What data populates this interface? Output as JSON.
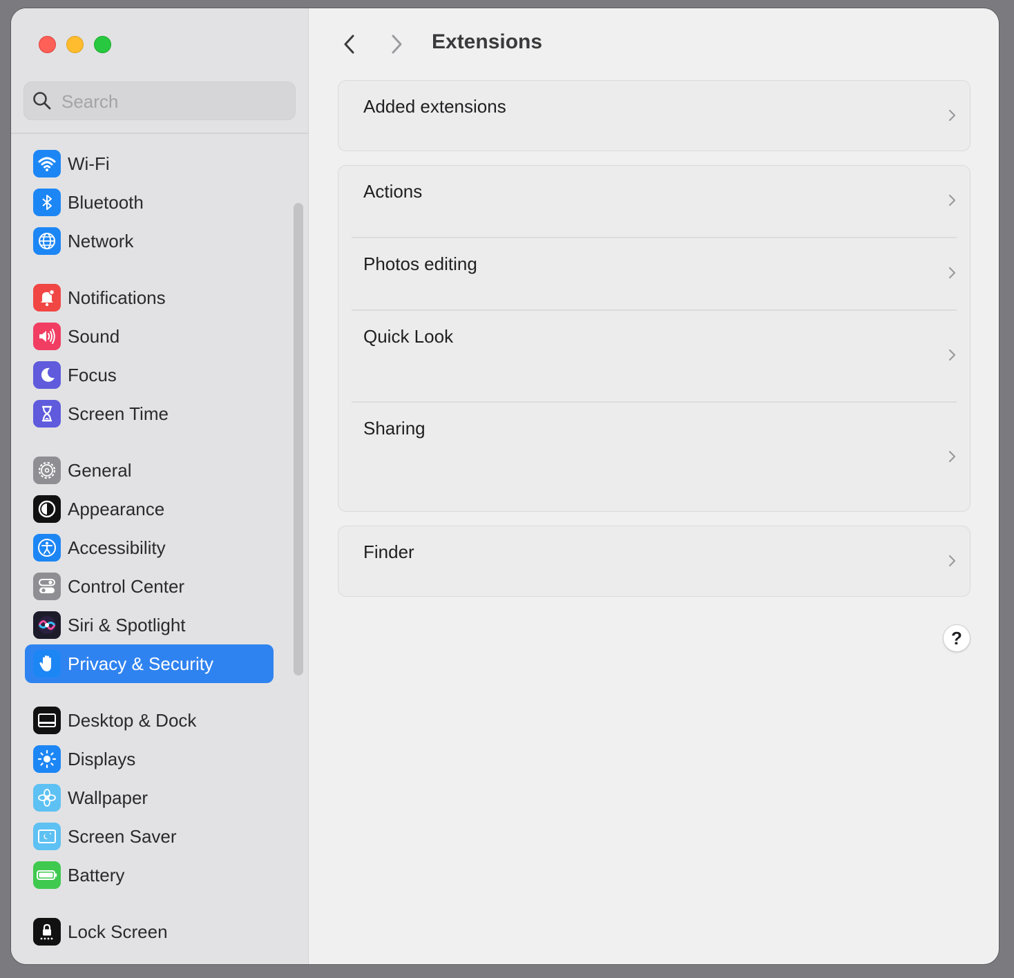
{
  "search": {
    "placeholder": "Search"
  },
  "sidebar": {
    "items": [
      {
        "label": "Wi-Fi",
        "icon": "wifi-icon"
      },
      {
        "label": "Bluetooth",
        "icon": "bluetooth-icon"
      },
      {
        "label": "Network",
        "icon": "globe-icon"
      },
      {
        "label": "Notifications",
        "icon": "bell-icon"
      },
      {
        "label": "Sound",
        "icon": "speaker-icon"
      },
      {
        "label": "Focus",
        "icon": "moon-icon"
      },
      {
        "label": "Screen Time",
        "icon": "hourglass-icon"
      },
      {
        "label": "General",
        "icon": "gear-icon"
      },
      {
        "label": "Appearance",
        "icon": "appearance-icon"
      },
      {
        "label": "Accessibility",
        "icon": "accessibility-icon"
      },
      {
        "label": "Control Center",
        "icon": "toggles-icon"
      },
      {
        "label": "Siri & Spotlight",
        "icon": "siri-icon"
      },
      {
        "label": "Privacy & Security",
        "icon": "hand-icon",
        "selected": true
      },
      {
        "label": "Desktop & Dock",
        "icon": "dock-icon"
      },
      {
        "label": "Displays",
        "icon": "sun-icon"
      },
      {
        "label": "Wallpaper",
        "icon": "flower-icon"
      },
      {
        "label": "Screen Saver",
        "icon": "screensaver-icon"
      },
      {
        "label": "Battery",
        "icon": "battery-icon"
      },
      {
        "label": "Lock Screen",
        "icon": "lock-icon"
      }
    ]
  },
  "header": {
    "title": "Extensions"
  },
  "groups": {
    "added": {
      "label": "Added extensions"
    },
    "actions": {
      "label": "Actions"
    },
    "photos": {
      "label": "Photos editing"
    },
    "quicklook": {
      "label": "Quick Look"
    },
    "sharing": {
      "label": "Sharing"
    },
    "finder": {
      "label": "Finder"
    }
  },
  "help": {
    "label": "?"
  },
  "colors": {
    "accent": "#2f83f0",
    "window_bg": "#f0f0f0",
    "sidebar_bg": "#e2e2e4"
  }
}
